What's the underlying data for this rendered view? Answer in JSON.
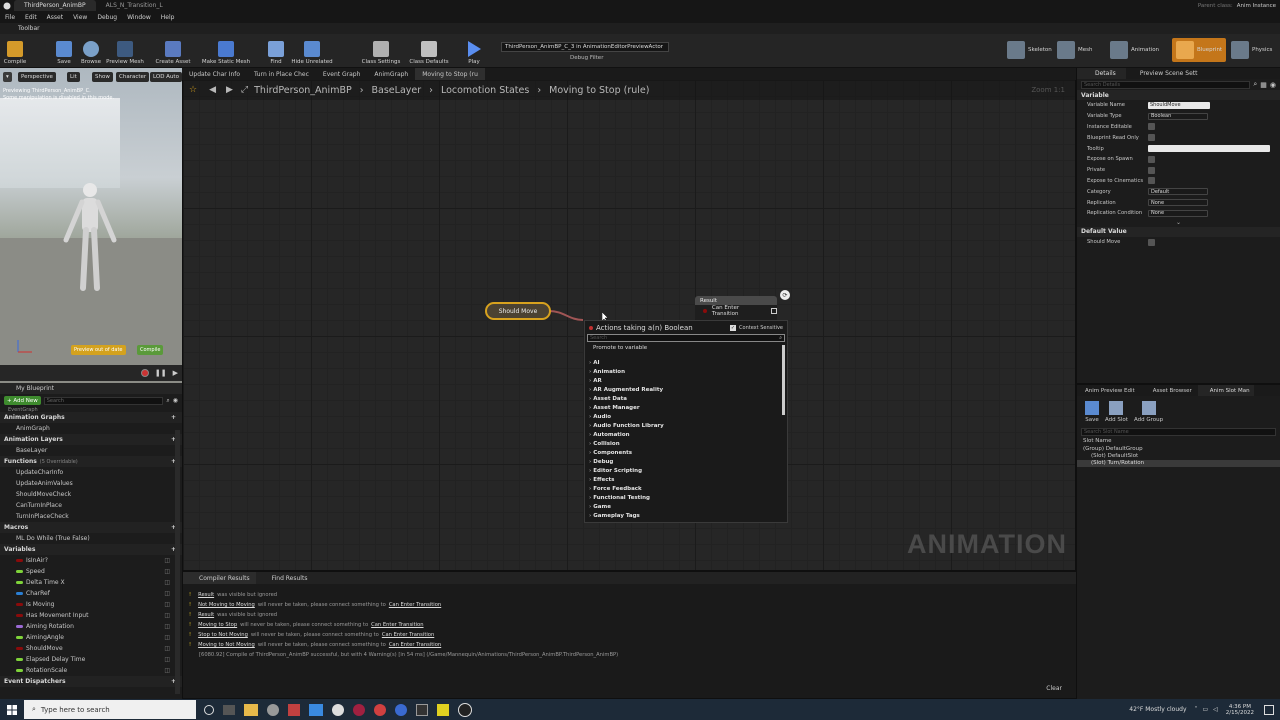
{
  "window": {
    "tabs": [
      "ThirdPerson_AnimBP",
      "ALS_N_Transition_L"
    ],
    "right_label": "Parent class:",
    "right_value": "Anim Instance"
  },
  "menu": [
    "File",
    "Edit",
    "Asset",
    "View",
    "Debug",
    "Window",
    "Help"
  ],
  "toolbar_label": "Toolbar",
  "toolbar": {
    "buttons": [
      "Compile",
      "Save",
      "Browse",
      "Preview Mesh",
      "Create Asset",
      "Make Static Mesh",
      "Find",
      "Hide Unrelated",
      "Class Settings",
      "Class Defaults",
      "Play"
    ],
    "debug_filter_value": "ThirdPerson_AnimBP_C_3 in AnimationEditorPreviewActor",
    "debug_filter_label": "Debug Filter",
    "modes": [
      "Skeleton",
      "Mesh",
      "Animation",
      "Blueprint",
      "Physics"
    ]
  },
  "viewport": {
    "buttons": [
      "Perspective",
      "Lit",
      "Show",
      "Character",
      "LOD Auto"
    ],
    "notice_1": "Previewing ThirdPerson_AnimBP_C.",
    "notice_2": "Some manipulation is disabled in this mode.",
    "preview_label": "Preview out of date",
    "compile_label": "Compile"
  },
  "graph": {
    "tabs": [
      "Update Char Info",
      "Turn in Place Chec",
      "Event Graph",
      "AnimGraph",
      "Moving to Stop (ru"
    ],
    "breadcrumb": [
      "ThirdPerson_AnimBP",
      "BaseLayer",
      "Locomotion States",
      "Moving to Stop (rule)"
    ],
    "zoom": "Zoom 1:1",
    "watermark": "ANIMATION",
    "node_should_move": "Should Move",
    "result_title": "Result",
    "result_pin": "Can Enter Transition"
  },
  "context_menu": {
    "title": "Actions taking a(n) Boolean",
    "context_sensitive": "Context Sensitive",
    "search_placeholder": "Search",
    "promote": "Promote to variable",
    "categories": [
      "AI",
      "Animation",
      "AR",
      "AR Augmented Reality",
      "Asset Data",
      "Asset Manager",
      "Audio",
      "Audio Function Library",
      "Automation",
      "Collision",
      "Components",
      "Debug",
      "Editor Scripting",
      "Effects",
      "Force Feedback",
      "Functional Testing",
      "Game",
      "Gameplay Tags"
    ]
  },
  "compiler": {
    "tabs": [
      "Compiler Results",
      "Find Results"
    ],
    "lines": [
      {
        "a": "Result",
        "b": "was visible but ignored",
        "c": ""
      },
      {
        "a": "Not Moving to Moving",
        "b": "will never be taken, please connect something to",
        "c": "Can Enter Transition"
      },
      {
        "a": "Result",
        "b": "was visible but ignored",
        "c": ""
      },
      {
        "a": "Moving to Stop",
        "b": "will never be taken, please connect something to",
        "c": "Can Enter Transition"
      },
      {
        "a": "Stop to Not Moving",
        "b": "will never be taken, please connect something to",
        "c": "Can Enter Transition"
      },
      {
        "a": "Moving to Not Moving",
        "b": "will never be taken, please connect something to",
        "c": "Can Enter Transition"
      }
    ],
    "summary": "[6080.92] Compile of ThirdPerson_AnimBP successful, but with 4 Warning(s) [in 54 ms] (/Game/Mannequin/Animations/ThirdPerson_AnimBP.ThirdPerson_AnimBP)",
    "clear": "Clear"
  },
  "my_blueprint": {
    "title": "My Blueprint",
    "add_new": "+ Add New",
    "search_placeholder": "Search",
    "cut_top": "EventGraph",
    "sections": {
      "anim_graphs": "Animation Graphs",
      "anim_layers": "Animation Layers",
      "functions": "Functions",
      "functions_count": "(5 Overridable)",
      "macros": "Macros",
      "variables": "Variables",
      "dispatchers": "Event Dispatchers"
    },
    "anim_graph_items": [
      "AnimGraph"
    ],
    "layer_items": [
      "BaseLayer"
    ],
    "function_items": [
      "UpdateCharInfo",
      "UpdateAnimValues",
      "ShouldMoveCheck",
      "CanTurnInPlace",
      "TurnInPlaceCheck"
    ],
    "macro_items": [
      "ML Do While (True False)"
    ],
    "variable_items": [
      {
        "name": "IsInAir?",
        "color": "#8a0b0b"
      },
      {
        "name": "Speed",
        "color": "#7fd33a"
      },
      {
        "name": "Delta Time X",
        "color": "#7fd33a"
      },
      {
        "name": "CharRef",
        "color": "#2a7fd3"
      },
      {
        "name": "Is Moving",
        "color": "#8a0b0b"
      },
      {
        "name": "Has Movement Input",
        "color": "#8a0b0b"
      },
      {
        "name": "Aiming Rotation",
        "color": "#9b6ad3"
      },
      {
        "name": "AimingAngle",
        "color": "#7fd33a"
      },
      {
        "name": "ShouldMove",
        "color": "#8a0b0b"
      },
      {
        "name": "Elapsed Delay Time",
        "color": "#7fd33a"
      },
      {
        "name": "RotationScale",
        "color": "#7fd33a"
      }
    ]
  },
  "details": {
    "tabs": [
      "Details",
      "Preview Scene Sett"
    ],
    "search_placeholder": "Search Details",
    "section_variable": "Variable",
    "rows": [
      {
        "label": "Variable Name",
        "value": "ShouldMove",
        "type": "text"
      },
      {
        "label": "Variable Type",
        "value": "Boolean",
        "type": "select"
      },
      {
        "label": "Instance Editable",
        "type": "check"
      },
      {
        "label": "Blueprint Read Only",
        "type": "check"
      },
      {
        "label": "Tooltip",
        "value": "",
        "type": "text"
      },
      {
        "label": "Expose on Spawn",
        "type": "check"
      },
      {
        "label": "Private",
        "type": "check"
      },
      {
        "label": "Expose to Cinematics",
        "type": "check"
      },
      {
        "label": "Category",
        "value": "Default",
        "type": "select"
      },
      {
        "label": "Replication",
        "value": "None",
        "type": "select"
      },
      {
        "label": "Replication Condition",
        "value": "None",
        "type": "select"
      }
    ],
    "section_default": "Default Value",
    "default_row": "Should Move"
  },
  "slots": {
    "tabs": [
      "Anim Preview Edit",
      "Asset Browser",
      "Anim Slot Man"
    ],
    "buttons": [
      "Save",
      "Add Slot",
      "Add Group"
    ],
    "search_placeholder": "Search Slot Name",
    "col_header": "Slot Name",
    "items": [
      "(Group) DefaultGroup",
      "(Slot) DefaultSlot",
      "(Slot) Turn/Rotation"
    ]
  },
  "taskbar": {
    "search_placeholder": "Type here to search",
    "weather": "42°F  Mostly cloudy",
    "time": "4:36 PM",
    "date": "2/15/2022"
  },
  "colors": {
    "accent_orange": "#d8a21e",
    "boolean_red": "#8a0b0b",
    "selected_mode": "#c4761a"
  }
}
